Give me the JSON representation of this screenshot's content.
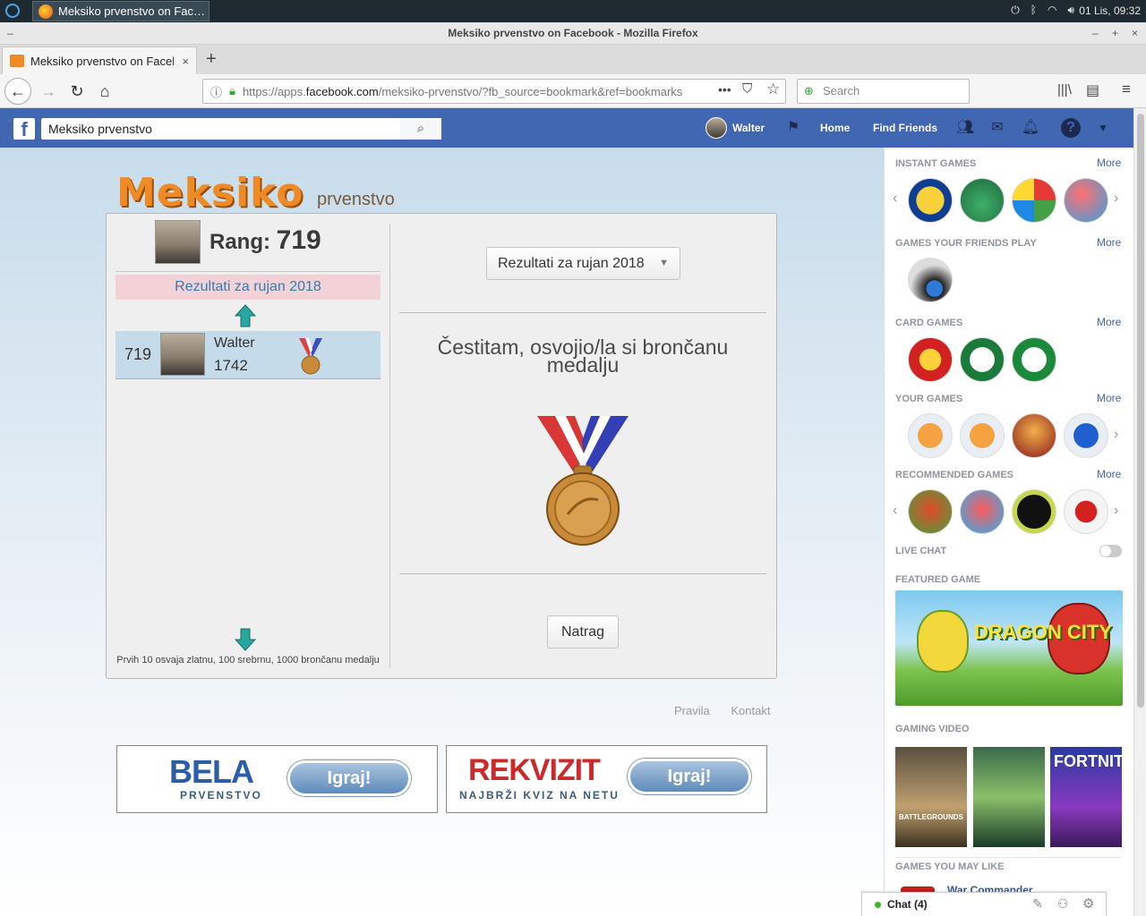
{
  "taskbar": {
    "task_title": "Meksiko prvenstvo on Fac…",
    "clock": "01 Lis, 09:32"
  },
  "window": {
    "title": "Meksiko prvenstvo on Facebook - Mozilla Firefox"
  },
  "tab": {
    "title": "Meksiko prvenstvo on Facebook"
  },
  "url": {
    "prefix": "https://apps.",
    "domain": "facebook.com",
    "rest": "/meksiko-prvenstvo/?fb_source=bookmark&ref=bookmarks"
  },
  "search": {
    "placeholder": "Search"
  },
  "fb": {
    "logo": "f",
    "search_value": "Meksiko prvenstvo",
    "user": "Walter",
    "home": "Home",
    "find_friends": "Find Friends"
  },
  "game": {
    "logo_main": "Meksiko",
    "logo_sub": "prvenstvo",
    "rang_label": "Rang:",
    "rang_value": "719",
    "results_label": "Rezultati za rujan 2018",
    "row": {
      "rank": "719",
      "name": "Walter",
      "points": "1742"
    },
    "footnote": "Prvih 10 osvaja zlatnu, 100 srebrnu, 1000 brončanu medalju",
    "select_value": "Rezultati za rujan 2018",
    "congrats": "Čestitam, osvojio/la si brončanu medalju",
    "back_button": "Natrag",
    "links": {
      "rules": "Pravila",
      "contact": "Kontakt"
    }
  },
  "promos": [
    {
      "title_a": "BELA",
      "sub": "PRVENSTVO",
      "button": "Igraj!"
    },
    {
      "title_a": "REKVIZIT",
      "sub": "NAJBRŽI KVIZ NA NETU",
      "button": "Igraj!"
    }
  ],
  "sidebar": {
    "instant_games": "INSTANT GAMES",
    "friends_games": "GAMES YOUR FRIENDS PLAY",
    "card_games": "CARD GAMES",
    "your_games": "YOUR GAMES",
    "recommended_games": "RECOMMENDED GAMES",
    "live_chat": "LIVE CHAT",
    "featured_game": "FEATURED GAME",
    "featured_title": "DRAGON CITY",
    "gaming_video": "GAMING VIDEO",
    "games_may_like": "GAMES YOU MAY LIKE",
    "more": "More",
    "war_commander": "War Commander",
    "video_labels": [
      "BATTLEGROUNDS",
      "",
      "FORTNITE"
    ]
  },
  "chat": {
    "label": "Chat (4)"
  }
}
